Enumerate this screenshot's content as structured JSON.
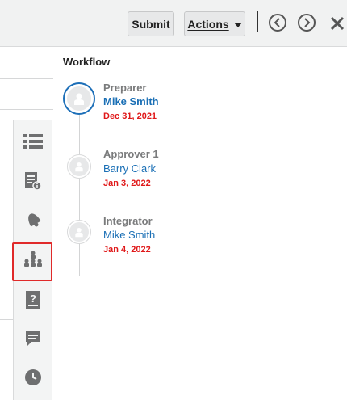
{
  "toolbar": {
    "submit_label": "Submit",
    "actions_label": "Actions",
    "icons": [
      "chevron-left-icon",
      "chevron-right-icon",
      "close-icon"
    ]
  },
  "rail": {
    "items": [
      "list-icon",
      "document-info-icon",
      "bell-icon",
      "workflow-icon",
      "help-icon",
      "comment-icon",
      "clock-icon"
    ],
    "active": "workflow-icon",
    "highlight_color": "#e02a2a"
  },
  "workflow": {
    "title": "Workflow",
    "steps": [
      {
        "role": "Preparer",
        "name": "Mike Smith",
        "date": "Dec 31, 2021",
        "active": true
      },
      {
        "role": "Approver 1",
        "name": "Barry Clark",
        "date": "Jan 3, 2022",
        "active": false
      },
      {
        "role": "Integrator",
        "name": "Mike Smith",
        "date": "Jan 4, 2022",
        "active": false
      }
    ]
  },
  "colors": {
    "link": "#1a6fb5",
    "date": "#e0191a",
    "active_ring": "#1d6fb8"
  }
}
